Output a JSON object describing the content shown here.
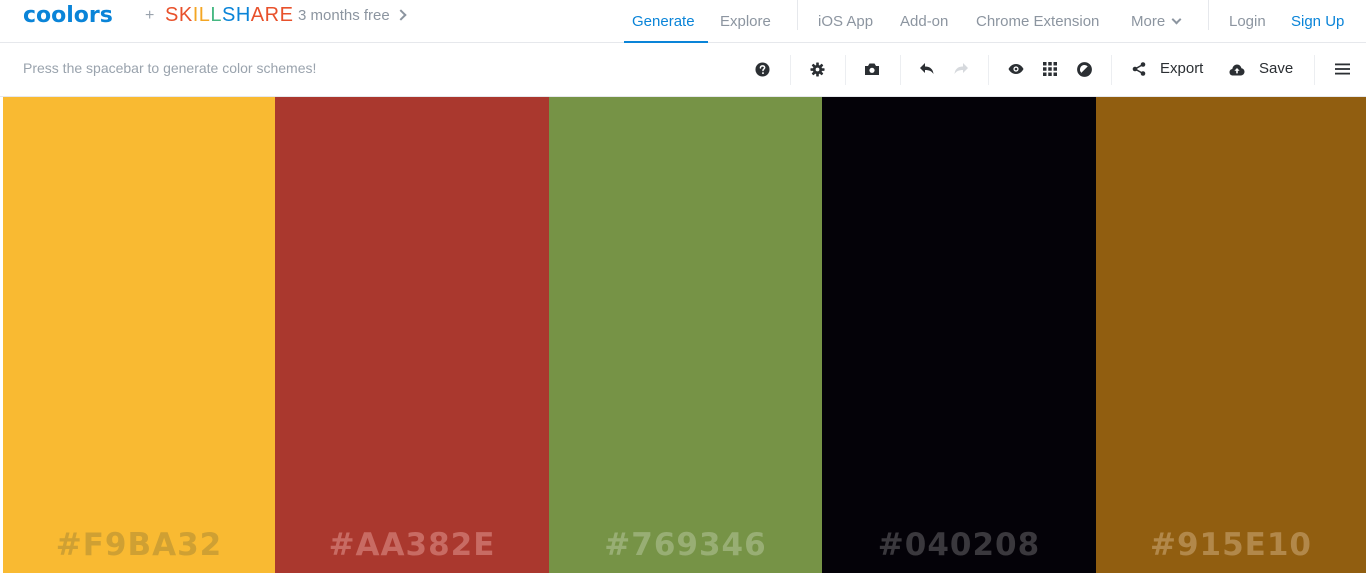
{
  "header": {
    "logo": "coolors",
    "plus": "+",
    "partner_letters": [
      {
        "ch": "S",
        "color": "#e8512b"
      },
      {
        "ch": "K",
        "color": "#e8512b"
      },
      {
        "ch": "I",
        "color": "#f4a623"
      },
      {
        "ch": "L",
        "color": "#f4a623"
      },
      {
        "ch": "L",
        "color": "#46b882"
      },
      {
        "ch": "S",
        "color": "#0a84d8"
      },
      {
        "ch": "H",
        "color": "#0a84d8"
      },
      {
        "ch": "A",
        "color": "#e8512b"
      },
      {
        "ch": "R",
        "color": "#e8512b"
      },
      {
        "ch": "E",
        "color": "#e8512b"
      }
    ],
    "promo": "3 months free",
    "nav": {
      "generate": "Generate",
      "explore": "Explore",
      "ios_app": "iOS App",
      "addon": "Add-on",
      "chrome_extension": "Chrome Extension",
      "more": "More",
      "login": "Login",
      "signup": "Sign Up"
    },
    "accent_color": "#0a84d8"
  },
  "toolbar": {
    "hint": "Press the spacebar to generate color schemes!",
    "export_label": "Export",
    "save_label": "Save",
    "icons": [
      "help-icon",
      "settings-icon",
      "camera-icon",
      "undo-icon",
      "redo-icon",
      "eye-icon",
      "grid-icon",
      "contrast-icon",
      "share-icon",
      "cloud-upload-icon",
      "menu-icon"
    ]
  },
  "palette": {
    "colors": [
      {
        "hex": "#F9BA32",
        "label": "#F9BA32",
        "label_color": "#cfa033"
      },
      {
        "hex": "#AA382E",
        "label": "#AA382E",
        "label_color": "#c86b63"
      },
      {
        "hex": "#769346",
        "label": "#769346",
        "label_color": "#98ae74"
      },
      {
        "hex": "#040208",
        "label": "#040208",
        "label_color": "#3a383d"
      },
      {
        "hex": "#915E10",
        "label": "#915E10",
        "label_color": "#b2884a"
      }
    ]
  }
}
